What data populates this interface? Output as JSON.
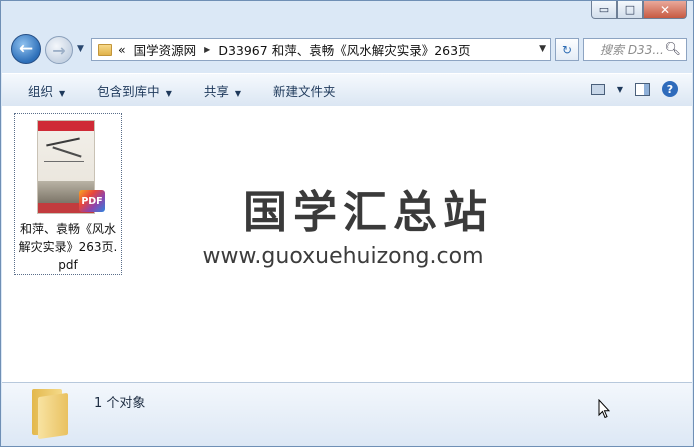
{
  "window": {
    "minimize_symbol": "▭",
    "maximize_symbol": "□",
    "close_symbol": "✕"
  },
  "nav": {
    "back_symbol": "←",
    "forward_symbol": "→",
    "history_dropdown_symbol": "▼",
    "refresh_symbol": "↻"
  },
  "address": {
    "overflow": "«",
    "separator": "▶",
    "segments": [
      "国学资源网",
      "D33967 和萍、袁畅《风水解灾实录》263页"
    ],
    "dropdown_symbol": "▼"
  },
  "search": {
    "placeholder": "搜索 D33...",
    "icon": "search-icon"
  },
  "toolbar": {
    "organize": "组织",
    "include_in_library": "包含到库中",
    "share": "共享",
    "new_folder": "新建文件夹",
    "dropdown_symbol": "▼",
    "help_symbol": "?"
  },
  "content": {
    "files": [
      {
        "name": "和萍、袁畅《风水解灾实录》263页.pdf",
        "type": "pdf",
        "badge": "PDF"
      }
    ],
    "watermark_title": "国学汇总站",
    "watermark_url": "www.guoxuehuizong.com"
  },
  "details": {
    "object_count": "1 个对象"
  },
  "colors": {
    "window_frame": "#dbe8f6",
    "toolbar_text": "#1e395b",
    "close_button": "#c75a42"
  }
}
